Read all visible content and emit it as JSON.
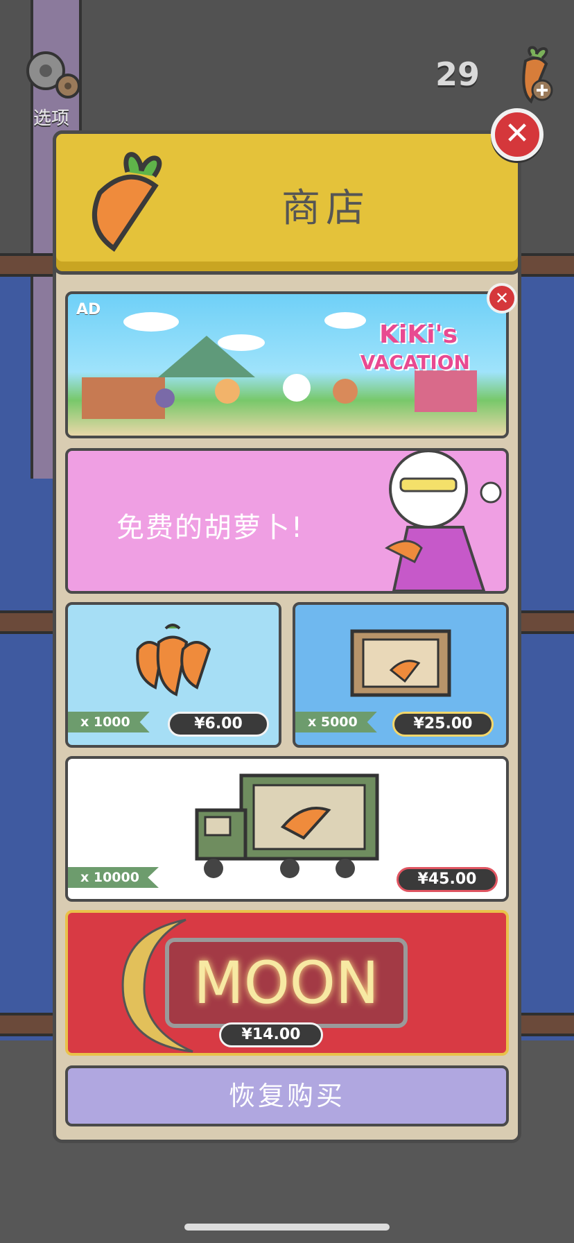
{
  "hud": {
    "settings_label": "选项",
    "carrot_count": "29"
  },
  "shop": {
    "title": "商店",
    "close_glyph": "✕",
    "ad": {
      "badge": "AD",
      "logo_line1": "KiKi's",
      "logo_line2": "VACATION",
      "close_glyph": "✕"
    },
    "free_carrots": {
      "label": "免费的胡萝卜!"
    },
    "packs": [
      {
        "quantity": "x 1000",
        "price": "¥6.00"
      },
      {
        "quantity": "x 5000",
        "price": "¥25.00"
      },
      {
        "quantity": "x 10000",
        "price": "¥45.00"
      }
    ],
    "moon": {
      "sign": "MOON",
      "price": "¥14.00"
    },
    "restore_label": "恢复购买"
  },
  "colors": {
    "header_yellow": "#e4c23a",
    "close_red": "#d5373b",
    "free_pink": "#ef9fe3",
    "restore_purple": "#b0a7e0"
  }
}
